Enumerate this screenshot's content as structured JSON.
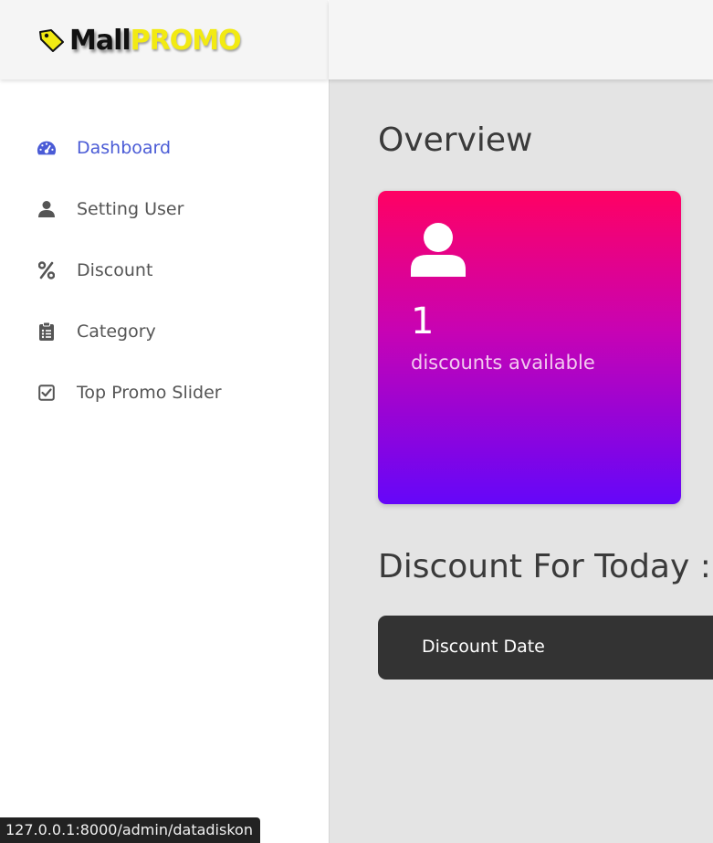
{
  "brand": {
    "part1": "Mall",
    "part2": "PROMO"
  },
  "sidebar": {
    "items": [
      {
        "label": "Dashboard",
        "icon": "dashboard-icon",
        "active": true
      },
      {
        "label": "Setting User",
        "icon": "user-icon"
      },
      {
        "label": "Discount",
        "icon": "percent-icon"
      },
      {
        "label": "Category",
        "icon": "clipboard-list-icon"
      },
      {
        "label": "Top Promo Slider",
        "icon": "check-square-icon"
      }
    ]
  },
  "main": {
    "title": "Overview",
    "card": {
      "count": "1",
      "text": "discounts available",
      "icon": "user-icon"
    },
    "section_title": "Discount For Today :",
    "table": {
      "columns": [
        "Discount Date"
      ]
    }
  },
  "status_bar": {
    "url": "127.0.0.1:8000/admin/datadiskon"
  },
  "colors": {
    "accent": "#4a5bd6",
    "card_gradient_top": "#ff0163",
    "card_gradient_bottom": "#6506f9",
    "table_header": "#333333",
    "logo_promo": "#f2ea12"
  }
}
